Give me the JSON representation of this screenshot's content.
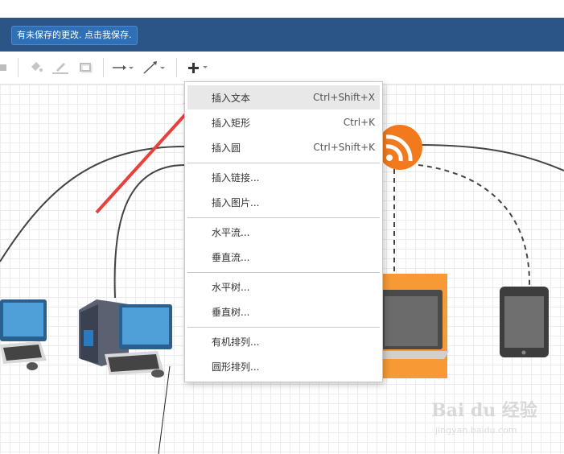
{
  "banner": {
    "unsaved_label": "有未保存的更改. 点击我保存."
  },
  "toolbar": {
    "icons": [
      "format-icon",
      "fill-color-icon",
      "line-color-icon",
      "shadow-icon",
      "connector-icon",
      "waypoint-icon",
      "insert-icon"
    ]
  },
  "insert_menu": {
    "items": [
      {
        "label": "插入文本",
        "shortcut": "Ctrl+Shift+X"
      },
      {
        "label": "插入矩形",
        "shortcut": "Ctrl+K"
      },
      {
        "label": "插入圆",
        "shortcut": "Ctrl+Shift+K"
      },
      {
        "label": "插入链接..."
      },
      {
        "label": "插入图片..."
      },
      {
        "label": "水平流..."
      },
      {
        "label": "垂直流..."
      },
      {
        "label": "水平树..."
      },
      {
        "label": "垂直树..."
      },
      {
        "label": "有机排列..."
      },
      {
        "label": "圆形排列..."
      }
    ]
  },
  "watermark": {
    "brand": "Bai du 经验",
    "url": "jingyan.baidu.com"
  },
  "colors": {
    "banner": "#2a5584",
    "rss_orange": "#f07a1d",
    "laptop_bg": "#f79a35",
    "arrow": "#e8403a"
  }
}
